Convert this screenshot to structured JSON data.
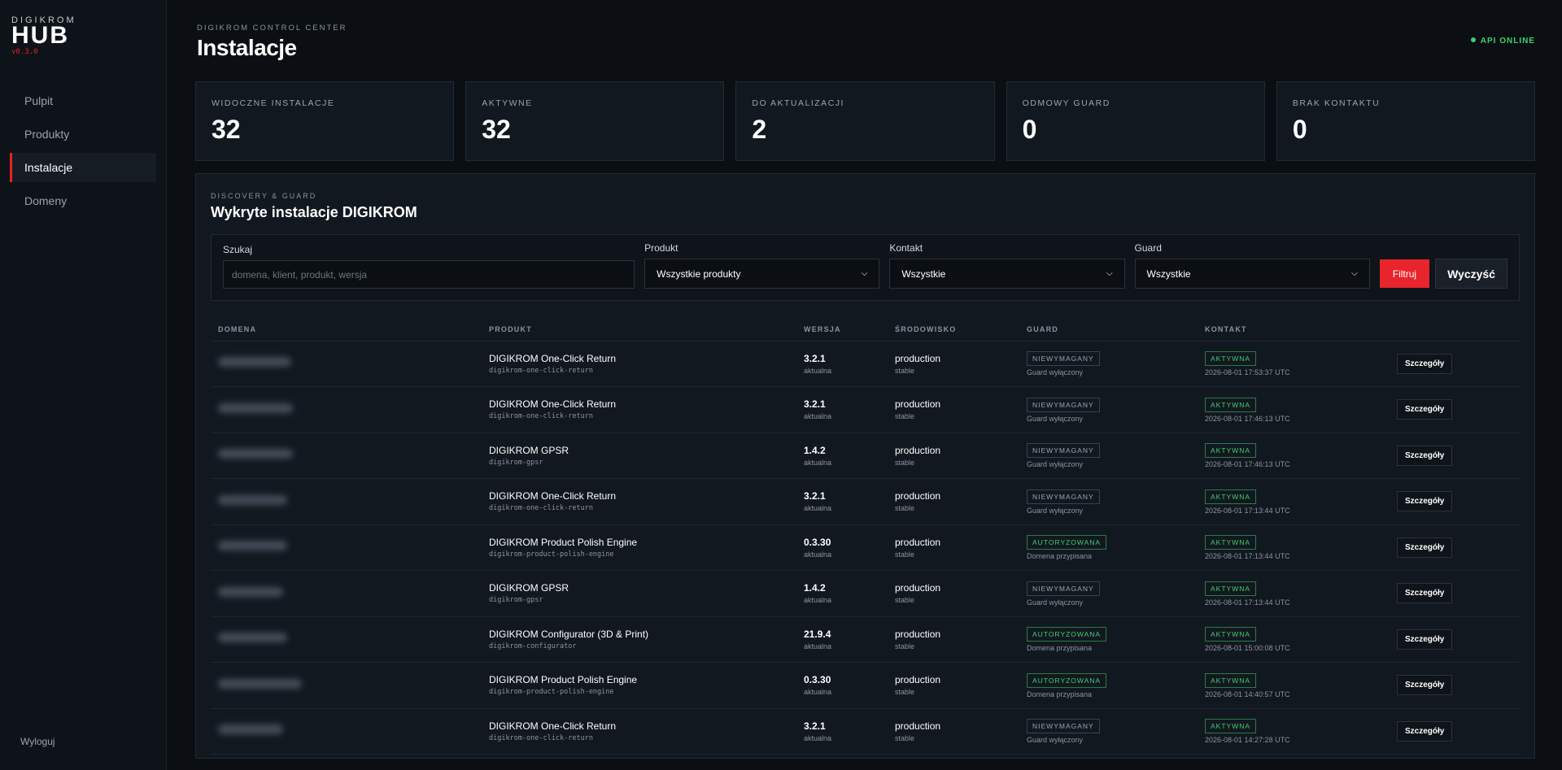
{
  "brand": {
    "top": "DIGIKROM",
    "main": "HUB",
    "version": "v0.3.0"
  },
  "sidebar": {
    "items": [
      {
        "label": "Pulpit"
      },
      {
        "label": "Produkty"
      },
      {
        "label": "Instalacje"
      },
      {
        "label": "Domeny"
      }
    ],
    "logout": "Wyloguj"
  },
  "header": {
    "eyebrow": "DIGIKROM CONTROL CENTER",
    "title": "Instalacje",
    "api_status": "API ONLINE"
  },
  "stats": [
    {
      "label": "WIDOCZNE INSTALACJE",
      "value": "32"
    },
    {
      "label": "AKTYWNE",
      "value": "32"
    },
    {
      "label": "DO AKTUALIZACJI",
      "value": "2"
    },
    {
      "label": "ODMOWY GUARD",
      "value": "0"
    },
    {
      "label": "BRAK KONTAKTU",
      "value": "0"
    }
  ],
  "panel": {
    "eyebrow": "DISCOVERY & GUARD",
    "title": "Wykryte instalacje DIGIKROM"
  },
  "filters": {
    "search_label": "Szukaj",
    "search_placeholder": "domena, klient, produkt, wersja",
    "product_label": "Produkt",
    "product_value": "Wszystkie produkty",
    "contact_label": "Kontakt",
    "contact_value": "Wszystkie",
    "guard_label": "Guard",
    "guard_value": "Wszystkie",
    "filter_button": "Filtruj",
    "clear_button": "Wyczyść"
  },
  "table": {
    "headers": [
      "DOMENA",
      "PRODUKT",
      "WERSJA",
      "ŚRODOWISKO",
      "GUARD",
      "KONTAKT"
    ],
    "detail_label": "Szczegóły",
    "rows": [
      {
        "product": "DIGIKROM One-Click Return",
        "slug": "digikrom-one-click-return",
        "version": "3.2.1",
        "version_note": "aktualna",
        "env": "production",
        "env_note": "stable",
        "guard": "NIEWYMAGANY",
        "guard_note": "Guard wyłączony",
        "contact": "AKTYWNA",
        "contact_time": "2026-08-01 17:53:37 UTC"
      },
      {
        "product": "DIGIKROM One-Click Return",
        "slug": "digikrom-one-click-return",
        "version": "3.2.1",
        "version_note": "aktualna",
        "env": "production",
        "env_note": "stable",
        "guard": "NIEWYMAGANY",
        "guard_note": "Guard wyłączony",
        "contact": "AKTYWNA",
        "contact_time": "2026-08-01 17:46:13 UTC"
      },
      {
        "product": "DIGIKROM GPSR",
        "slug": "digikrom-gpsr",
        "version": "1.4.2",
        "version_note": "aktualna",
        "env": "production",
        "env_note": "stable",
        "guard": "NIEWYMAGANY",
        "guard_note": "Guard wyłączony",
        "contact": "AKTYWNA",
        "contact_time": "2026-08-01 17:46:13 UTC"
      },
      {
        "product": "DIGIKROM One-Click Return",
        "slug": "digikrom-one-click-return",
        "version": "3.2.1",
        "version_note": "aktualna",
        "env": "production",
        "env_note": "stable",
        "guard": "NIEWYMAGANY",
        "guard_note": "Guard wyłączony",
        "contact": "AKTYWNA",
        "contact_time": "2026-08-01 17:13:44 UTC"
      },
      {
        "product": "DIGIKROM Product Polish Engine",
        "slug": "digikrom-product-polish-engine",
        "version": "0.3.30",
        "version_note": "aktualna",
        "env": "production",
        "env_note": "stable",
        "guard": "AUTORYZOWANA",
        "guard_note": "Domena przypisana",
        "contact": "AKTYWNA",
        "contact_time": "2026-08-01 17:13:44 UTC"
      },
      {
        "product": "DIGIKROM GPSR",
        "slug": "digikrom-gpsr",
        "version": "1.4.2",
        "version_note": "aktualna",
        "env": "production",
        "env_note": "stable",
        "guard": "NIEWYMAGANY",
        "guard_note": "Guard wyłączony",
        "contact": "AKTYWNA",
        "contact_time": "2026-08-01 17:13:44 UTC"
      },
      {
        "product": "DIGIKROM Configurator (3D & Print)",
        "slug": "digikrom-configurator",
        "version": "21.9.4",
        "version_note": "aktualna",
        "env": "production",
        "env_note": "stable",
        "guard": "AUTORYZOWANA",
        "guard_note": "Domena przypisana",
        "contact": "AKTYWNA",
        "contact_time": "2026-08-01 15:00:08 UTC"
      },
      {
        "product": "DIGIKROM Product Polish Engine",
        "slug": "digikrom-product-polish-engine",
        "version": "0.3.30",
        "version_note": "aktualna",
        "env": "production",
        "env_note": "stable",
        "guard": "AUTORYZOWANA",
        "guard_note": "Domena przypisana",
        "contact": "AKTYWNA",
        "contact_time": "2026-08-01 14:40:57 UTC"
      },
      {
        "product": "DIGIKROM One-Click Return",
        "slug": "digikrom-one-click-return",
        "version": "3.2.1",
        "version_note": "aktualna",
        "env": "production",
        "env_note": "stable",
        "guard": "NIEWYMAGANY",
        "guard_note": "Guard wyłączony",
        "contact": "AKTYWNA",
        "contact_time": "2026-08-01 14:27:28 UTC"
      }
    ]
  },
  "colors": {
    "accent": "#e8242c",
    "success": "#3fcf6a",
    "background": "#0b0f14"
  }
}
